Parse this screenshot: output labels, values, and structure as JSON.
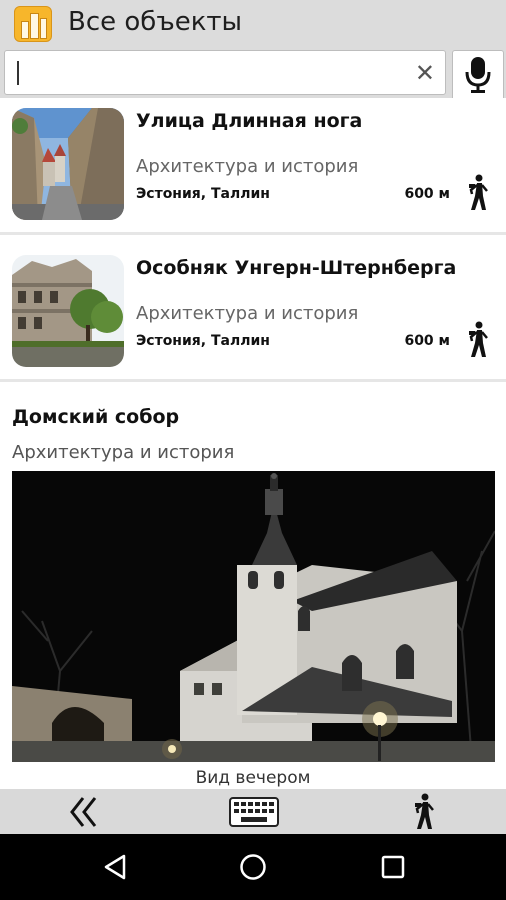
{
  "header": {
    "title": "Все объекты",
    "app_icon": "city-buildings-icon",
    "accent_color": "#f7b62b"
  },
  "search": {
    "value": "",
    "clear_icon": "close-icon",
    "clear_glyph": "✕",
    "voice_icon": "microphone-icon"
  },
  "results": [
    {
      "title": "Улица Длинная нога",
      "category": "Архитектура и история",
      "location": "Эстония, Таллин",
      "distance": "600 м",
      "action_icon": "pedestrian-icon"
    },
    {
      "title": "Особняк Унгерн-Штернберга",
      "category": "Архитектура и история",
      "location": "Эстония, Таллин",
      "distance": "600 м",
      "action_icon": "pedestrian-icon"
    }
  ],
  "featured": {
    "title": "Домский собор",
    "category": "Архитектура и история",
    "caption": "Вид вечером"
  },
  "bottom_bar": {
    "back_icon": "double-chevron-left-icon",
    "keyboard_icon": "keyboard-icon",
    "walk_icon": "pedestrian-icon"
  },
  "system_nav": {
    "back_icon": "triangle-back-icon",
    "home_icon": "circle-home-icon",
    "recents_icon": "square-recents-icon"
  }
}
